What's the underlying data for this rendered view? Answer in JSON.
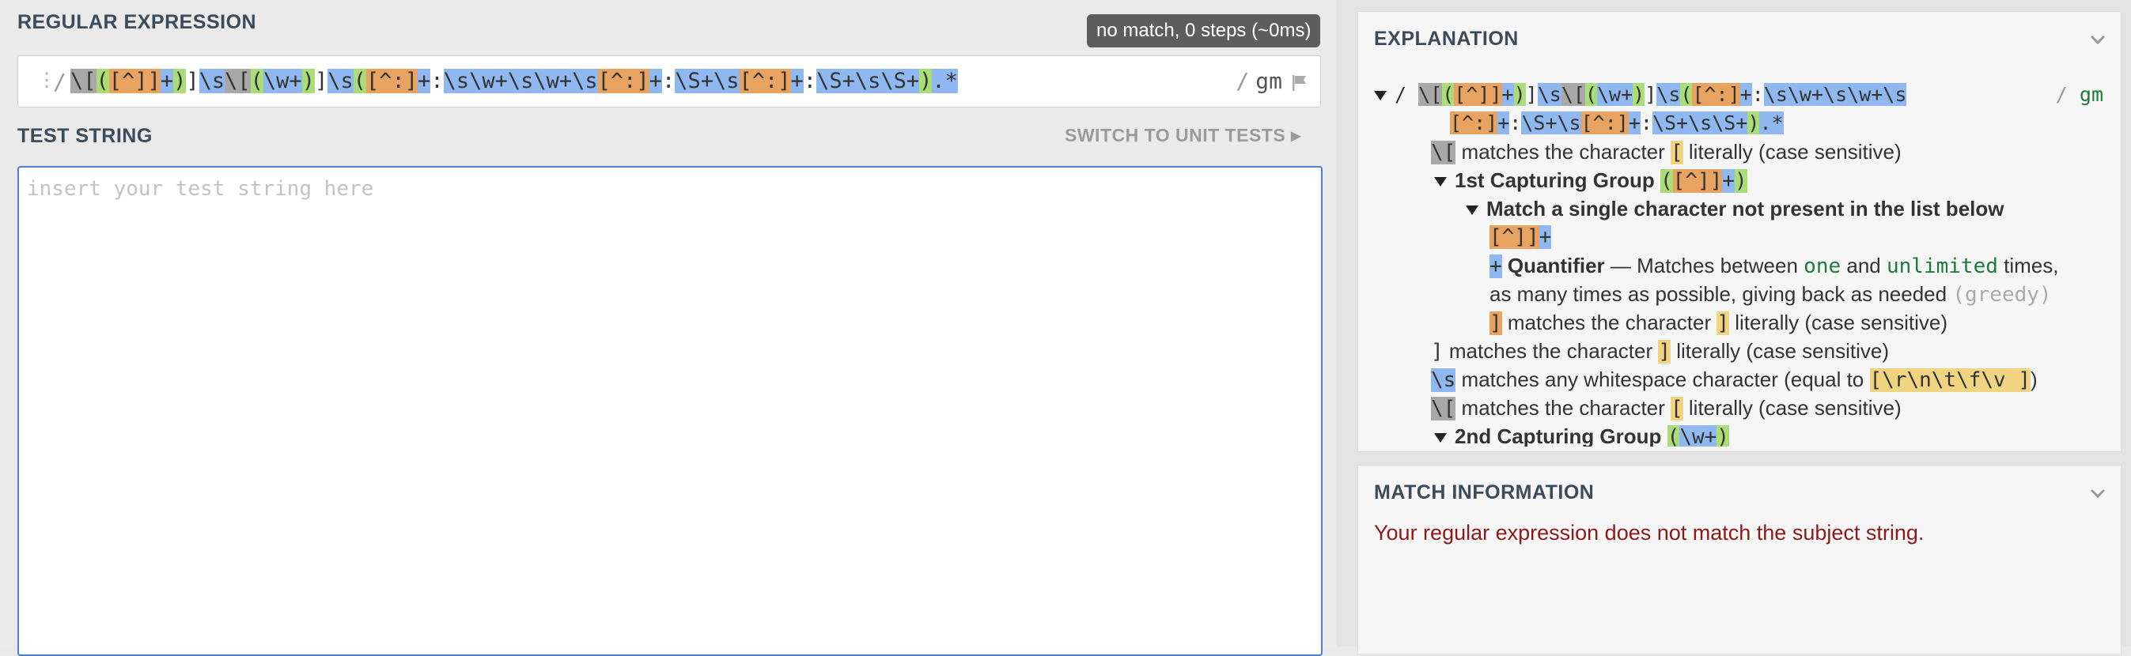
{
  "regex_panel": {
    "title": "REGULAR EXPRESSION",
    "status_badge": "no match, 0 steps (~0ms)",
    "delimiter": "/",
    "flags": "gm",
    "tokens": [
      {
        "t": "\\[",
        "c": "d"
      },
      {
        "t": "(",
        "c": "g"
      },
      {
        "t": "[^]",
        "c": "c"
      },
      {
        "t": "]",
        "c": "c"
      },
      {
        "t": "+",
        "c": "b"
      },
      {
        "t": ")",
        "c": "g"
      },
      {
        "t": "]",
        "c": ""
      },
      {
        "t": "\\s",
        "c": "b"
      },
      {
        "t": "\\[",
        "c": "d"
      },
      {
        "t": "(",
        "c": "g"
      },
      {
        "t": "\\w+",
        "c": "b"
      },
      {
        "t": ")",
        "c": "g"
      },
      {
        "t": "]",
        "c": ""
      },
      {
        "t": "\\s",
        "c": "b"
      },
      {
        "t": "(",
        "c": "g"
      },
      {
        "t": "[^:]",
        "c": "c"
      },
      {
        "t": "+",
        "c": "b"
      },
      {
        "t": ":",
        "c": ""
      },
      {
        "t": "\\s\\w+\\s\\w+\\s",
        "c": "b"
      },
      {
        "t": "[^:]",
        "c": "c"
      },
      {
        "t": "+",
        "c": "b"
      },
      {
        "t": ":",
        "c": ""
      },
      {
        "t": "\\S+\\s",
        "c": "b"
      },
      {
        "t": "[^:]",
        "c": "c"
      },
      {
        "t": "+",
        "c": "b"
      },
      {
        "t": ":",
        "c": ""
      },
      {
        "t": "\\S+\\s\\S+",
        "c": "b"
      },
      {
        "t": ")",
        "c": "g"
      },
      {
        "t": ".*",
        "c": "b"
      }
    ]
  },
  "test_panel": {
    "title": "TEST STRING",
    "switch_label": "SWITCH TO UNIT TESTS",
    "placeholder": "insert your test string here"
  },
  "explanation": {
    "title": "EXPLANATION",
    "flags": "gm",
    "regex_line1": [
      {
        "t": "\\[",
        "c": "d"
      },
      {
        "t": "(",
        "c": "g"
      },
      {
        "t": "[^]",
        "c": "c"
      },
      {
        "t": "]",
        "c": "c"
      },
      {
        "t": "+",
        "c": "b"
      },
      {
        "t": ")",
        "c": "g"
      },
      {
        "t": "]",
        "c": ""
      },
      {
        "t": "\\s",
        "c": "b"
      },
      {
        "t": "\\[",
        "c": "d"
      },
      {
        "t": "(",
        "c": "g"
      },
      {
        "t": "\\w+",
        "c": "b"
      },
      {
        "t": ")",
        "c": "g"
      },
      {
        "t": "]",
        "c": ""
      },
      {
        "t": "\\s",
        "c": "b"
      },
      {
        "t": "(",
        "c": "g"
      },
      {
        "t": "[^:]",
        "c": "c"
      },
      {
        "t": "+",
        "c": "b"
      },
      {
        "t": ":",
        "c": ""
      },
      {
        "t": "\\s\\w+\\s\\w+\\s",
        "c": "b"
      }
    ],
    "regex_line2": [
      {
        "t": "[^:]",
        "c": "c"
      },
      {
        "t": "+",
        "c": "b"
      },
      {
        "t": ":",
        "c": ""
      },
      {
        "t": "\\S+\\s",
        "c": "b"
      },
      {
        "t": "[^:]",
        "c": "c"
      },
      {
        "t": "+",
        "c": "b"
      },
      {
        "t": ":",
        "c": ""
      },
      {
        "t": "\\S+\\s\\S+",
        "c": "b"
      },
      {
        "t": ")",
        "c": "g"
      },
      {
        "t": ".*",
        "c": "b"
      }
    ],
    "lines": {
      "l1_tok": "\\[",
      "l1_pre": "matches the character",
      "l1_lit": "[",
      "l1_post": "literally (case sensitive)",
      "l2_label": "1st Capturing Group",
      "l3_label": "Match a single character not present in the list below",
      "l4_tok": "[^]]+",
      "l5_tok": "+",
      "l5_label": "Quantifier",
      "l5_mid1": "— Matches between",
      "l5_one": "one",
      "l5_and": "and",
      "l5_unl": "unlimited",
      "l5_times": "times,",
      "l6_text": "as many times as possible, giving back as needed",
      "l6_greedy": "(greedy)",
      "l7_tok": "]",
      "l7_pre": "matches the character",
      "l7_lit": "]",
      "l7_post": "literally (case sensitive)",
      "l8_tok": "]",
      "l8_pre": "matches the character",
      "l8_lit": "]",
      "l8_post": "literally (case sensitive)",
      "l9_tok": "\\s",
      "l9_pre": "matches any whitespace character (equal to",
      "l9_lit": "[\\r\\n\\t\\f\\v ]",
      "l9_post": ")",
      "l10_tok": "\\[",
      "l10_pre": "matches the character",
      "l10_lit": "[",
      "l10_post": "literally (case sensitive)",
      "l11_label": "2nd Capturing Group",
      "l11_tok": "\\w+"
    }
  },
  "match_info": {
    "title": "MATCH INFORMATION",
    "message": "Your regular expression does not match the subject string."
  },
  "colors": {
    "group": "#aadd77",
    "charclass": "#e9a361",
    "quantifier": "#8fb8f0",
    "escape": "#a8a8a8",
    "literal": "#f0d482",
    "error_text": "#8b1a1a"
  }
}
